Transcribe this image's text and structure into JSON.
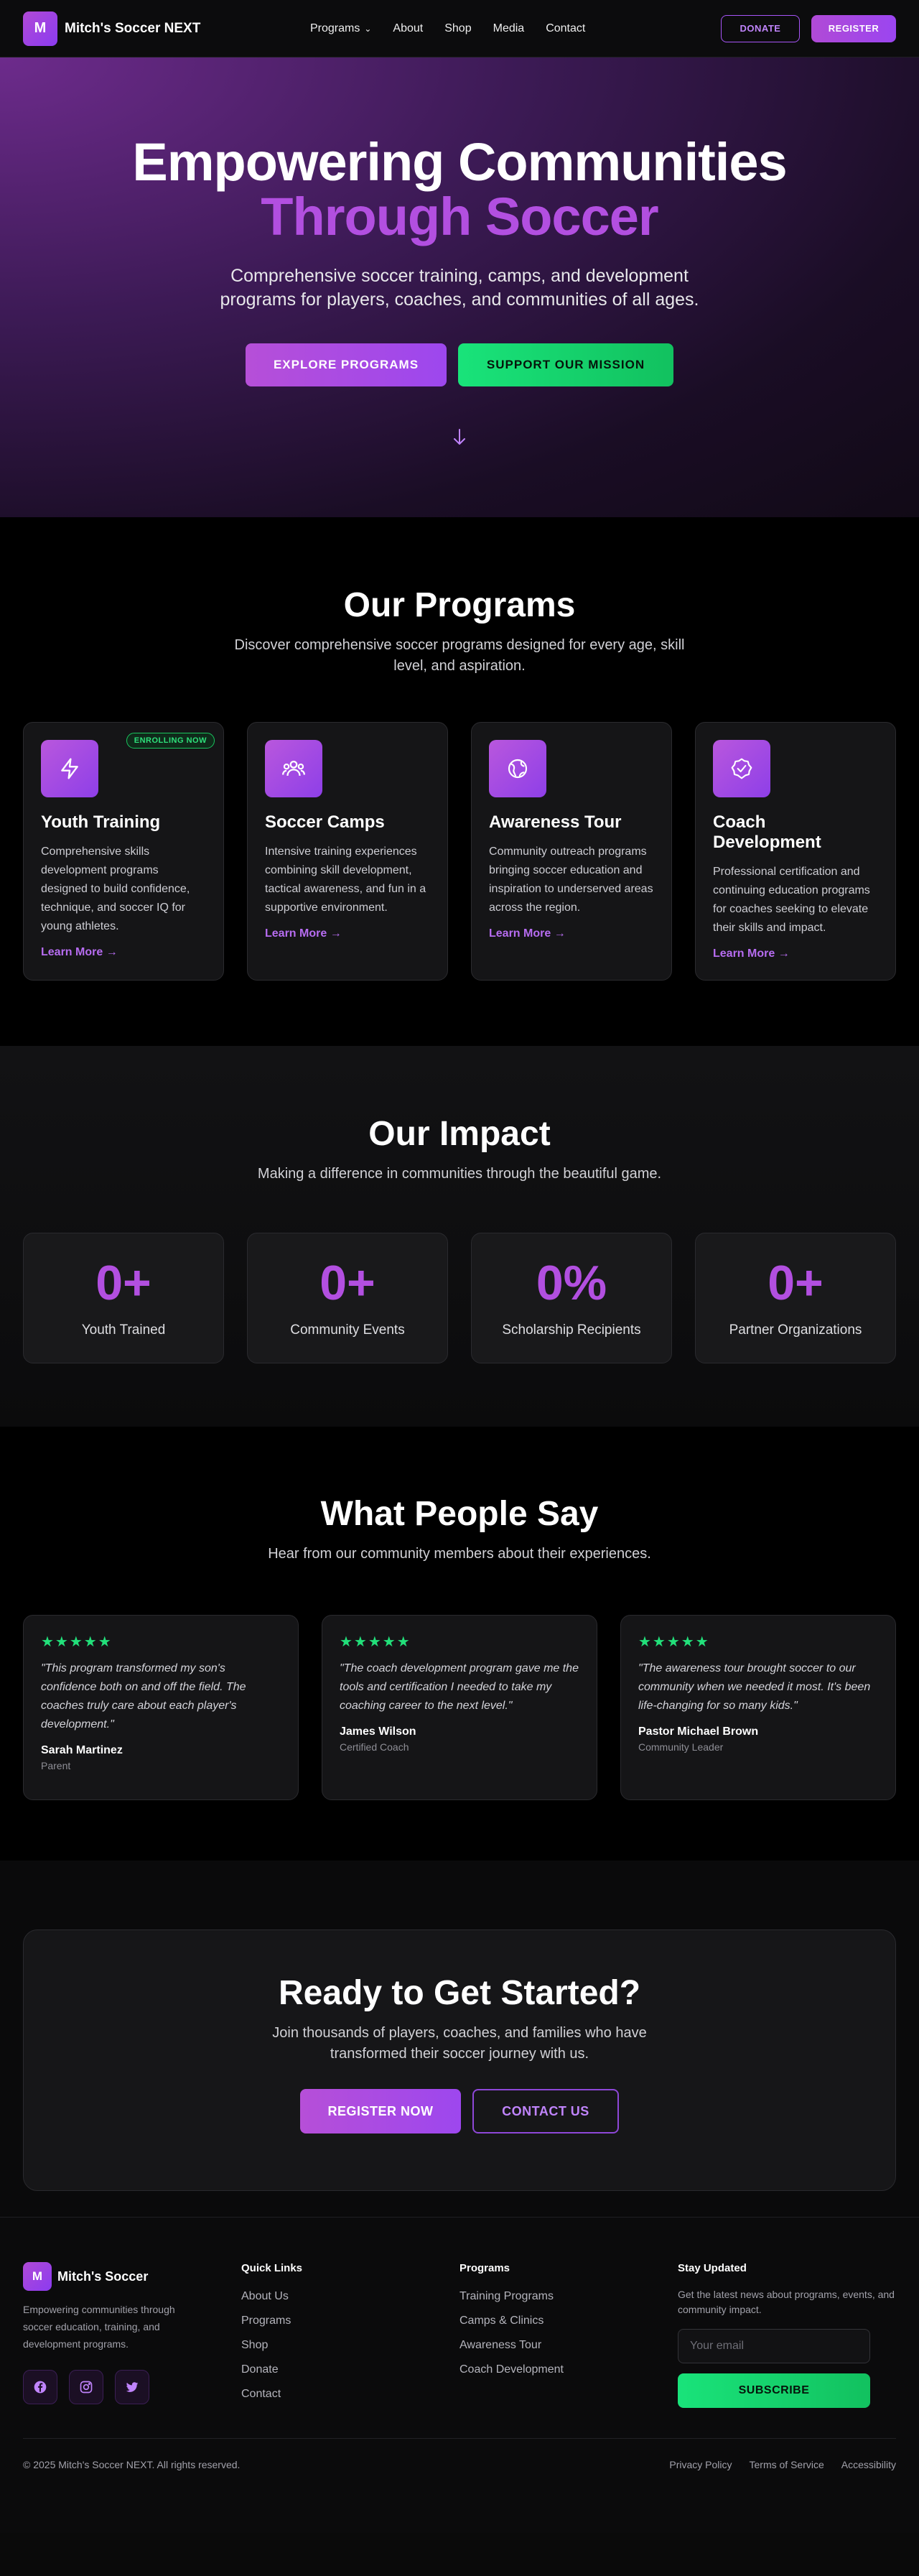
{
  "nav": {
    "brand_initial": "M",
    "brand": "Mitch's Soccer NEXT",
    "links": [
      "Programs",
      "About",
      "Shop",
      "Media",
      "Contact"
    ],
    "donate": "DONATE",
    "register": "REGISTER"
  },
  "hero": {
    "title_line1": "Empowering Communities",
    "title_line2": "Through Soccer",
    "subtitle": "Comprehensive soccer training, camps, and development programs for players, coaches, and communities of all ages.",
    "btn_explore": "EXPLORE PROGRAMS",
    "btn_support": "SUPPORT OUR MISSION"
  },
  "programs": {
    "title": "Our Programs",
    "subtitle": "Discover comprehensive soccer programs designed for every age, skill level, and aspiration.",
    "cards": [
      {
        "icon": "lightning-icon",
        "badge": "ENROLLING NOW",
        "title": "Youth Training",
        "desc": "Comprehensive skills development programs designed to build confidence, technique, and soccer IQ for young athletes.",
        "link": "Learn More →"
      },
      {
        "icon": "group-icon",
        "title": "Soccer Camps",
        "desc": "Intensive training experiences combining skill development, tactical awareness, and fun in a supportive environment.",
        "link": "Learn More →"
      },
      {
        "icon": "globe-icon",
        "title": "Awareness Tour",
        "desc": "Community outreach programs bringing soccer education and inspiration to underserved areas across the region.",
        "link": "Learn More →"
      },
      {
        "icon": "badge-check-icon",
        "title": "Coach Development",
        "desc": "Professional certification and continuing education programs for coaches seeking to elevate their skills and impact.",
        "link": "Learn More →"
      }
    ]
  },
  "impact": {
    "title": "Our Impact",
    "subtitle": "Making a difference in communities through the beautiful game.",
    "stats": [
      {
        "value": "0+",
        "label": "Youth Trained"
      },
      {
        "value": "0+",
        "label": "Community Events"
      },
      {
        "value": "0%",
        "label": "Scholarship Recipients"
      },
      {
        "value": "0+",
        "label": "Partner Organizations"
      }
    ]
  },
  "testimonials": {
    "title": "What People Say",
    "subtitle": "Hear from our community members about their experiences.",
    "items": [
      {
        "stars": "★★★★★",
        "quote": "\"This program transformed my son's confidence both on and off the field. The coaches truly care about each player's development.\"",
        "name": "Sarah Martinez",
        "role": "Parent"
      },
      {
        "stars": "★★★★★",
        "quote": "\"The coach development program gave me the tools and certification I needed to take my coaching career to the next level.\"",
        "name": "James Wilson",
        "role": "Certified Coach"
      },
      {
        "stars": "★★★★★",
        "quote": "\"The awareness tour brought soccer to our community when we needed it most. It's been life-changing for so many kids.\"",
        "name": "Pastor Michael Brown",
        "role": "Community Leader"
      }
    ]
  },
  "cta": {
    "title": "Ready to Get Started?",
    "subtitle": "Join thousands of players, coaches, and families who have transformed their soccer journey with us.",
    "register": "REGISTER NOW",
    "contact": "CONTACT US"
  },
  "footer": {
    "brand_initial": "M",
    "brand": "Mitch's Soccer",
    "desc": "Empowering communities through soccer education, training, and development programs.",
    "quick_title": "Quick Links",
    "quick_links": [
      "About Us",
      "Programs",
      "Shop",
      "Donate",
      "Contact"
    ],
    "programs_title": "Programs",
    "program_links": [
      "Training Programs",
      "Camps & Clinics",
      "Awareness Tour",
      "Coach Development"
    ],
    "news_title": "Stay Updated",
    "news_desc": "Get the latest news about programs, events, and community impact.",
    "email_placeholder": "Your email",
    "subscribe": "SUBSCRIBE",
    "copyright": "© 2025 Mitch's Soccer NEXT. All rights reserved.",
    "legal": [
      "Privacy Policy",
      "Terms of Service",
      "Accessibility"
    ]
  },
  "colors": {
    "accent": "#b24fe0",
    "green": "#19e37a",
    "bg": "#0a0a0a"
  }
}
